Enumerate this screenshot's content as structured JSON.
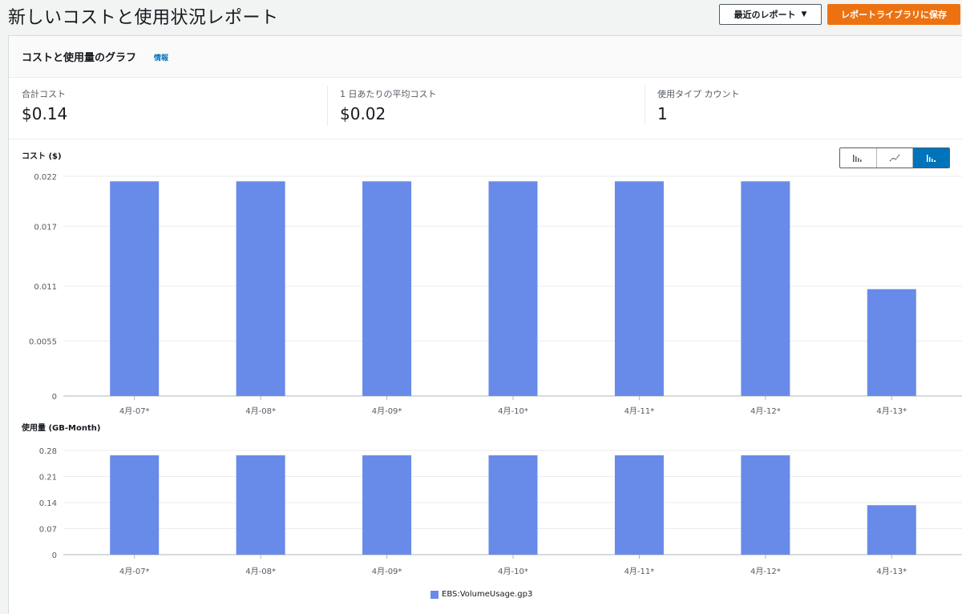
{
  "page": {
    "title": "新しいコストと使用状況レポート"
  },
  "toolbar": {
    "recent_reports_label": "最近のレポート",
    "save_label": "レポートライブラリに保存"
  },
  "panel": {
    "title": "コストと使用量のグラフ",
    "info_link": "情報"
  },
  "stats": [
    {
      "label": "合計コスト",
      "value": "$0.14"
    },
    {
      "label": "1 日あたりの平均コスト",
      "value": "$0.02"
    },
    {
      "label": "使用タイプ カウント",
      "value": "1"
    }
  ],
  "chart_type_buttons": [
    {
      "icon": "bar-chart-icon",
      "active": false
    },
    {
      "icon": "line-chart-icon",
      "active": false
    },
    {
      "icon": "stacked-bar-chart-icon",
      "active": true
    }
  ],
  "colors": {
    "series": "#688ae8",
    "accent": "#0073bb",
    "save_button": "#ec7211"
  },
  "chart_data": [
    {
      "type": "bar",
      "ylabel": "コスト ($)",
      "categories": [
        "4月-07*",
        "4月-08*",
        "4月-09*",
        "4月-10*",
        "4月-11*",
        "4月-12*",
        "4月-13*"
      ],
      "series": [
        {
          "name": "EBS:VolumeUsage.gp3",
          "values": [
            0.0215,
            0.0215,
            0.0215,
            0.0215,
            0.0215,
            0.0215,
            0.0107
          ]
        }
      ],
      "yticks": [
        "0",
        "0.0055",
        "0.011",
        "0.017",
        "0.022"
      ],
      "ylim": [
        0,
        0.022
      ],
      "grid": true
    },
    {
      "type": "bar",
      "ylabel": "使用量 (GB-Month)",
      "categories": [
        "4月-07*",
        "4月-08*",
        "4月-09*",
        "4月-10*",
        "4月-11*",
        "4月-12*",
        "4月-13*"
      ],
      "series": [
        {
          "name": "EBS:VolumeUsage.gp3",
          "values": [
            0.267,
            0.267,
            0.267,
            0.267,
            0.267,
            0.267,
            0.133
          ]
        }
      ],
      "yticks": [
        "0",
        "0.07",
        "0.14",
        "0.21",
        "0.28"
      ],
      "ylim": [
        0,
        0.28
      ],
      "grid": true
    }
  ],
  "legend": {
    "label": "EBS:VolumeUsage.gp3"
  }
}
